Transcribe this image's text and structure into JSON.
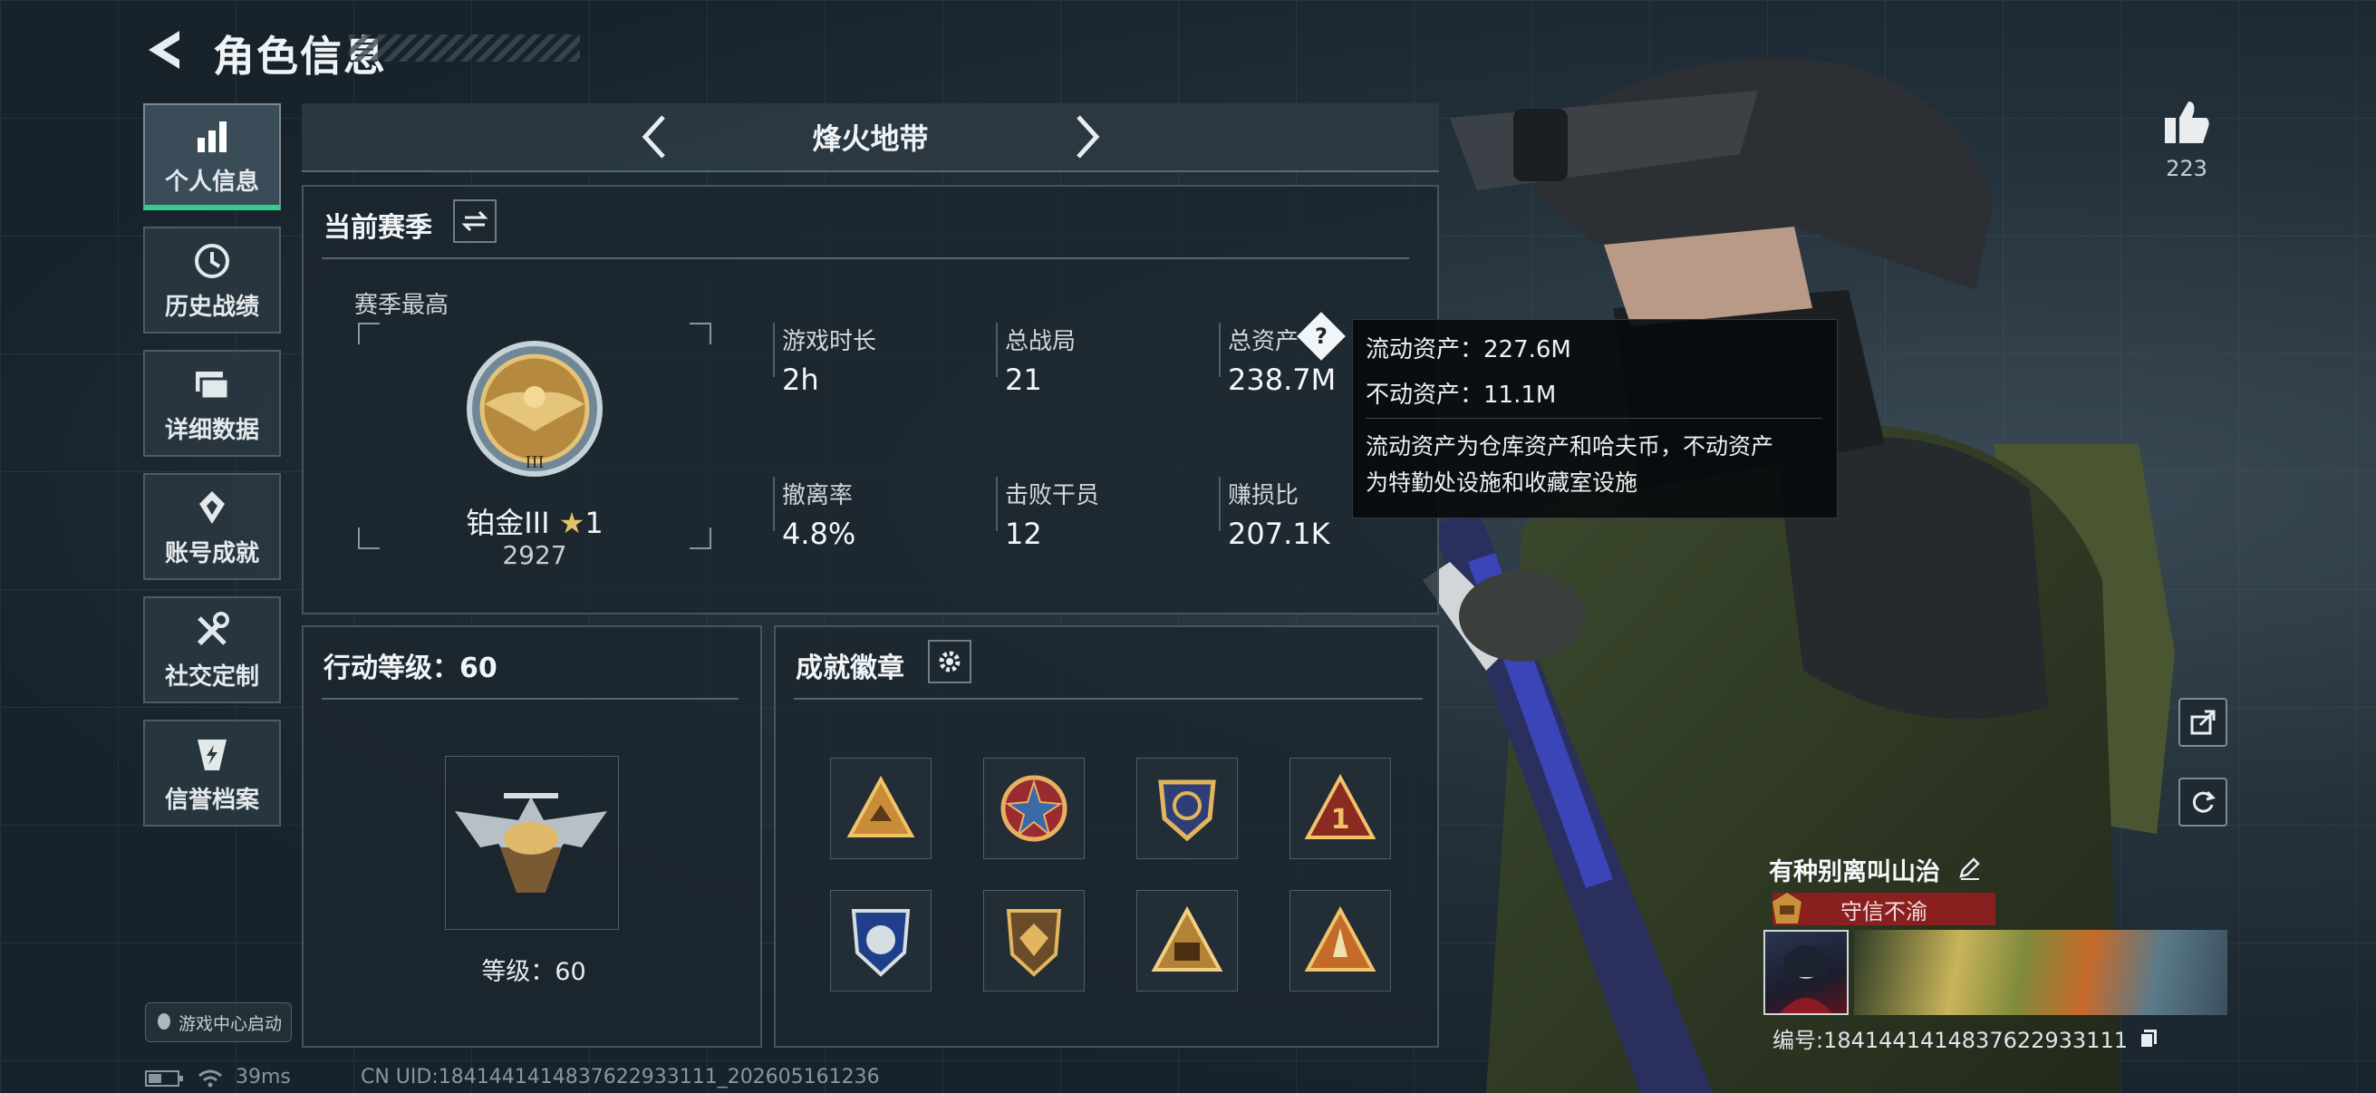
{
  "header": {
    "title": "角色信息"
  },
  "nav": {
    "items": [
      {
        "label": "个人信息",
        "icon": "bar-chart-icon",
        "active": true
      },
      {
        "label": "历史战绩",
        "icon": "history-icon"
      },
      {
        "label": "详细数据",
        "icon": "folder-icon"
      },
      {
        "label": "账号成就",
        "icon": "achievement-icon"
      },
      {
        "label": "社交定制",
        "icon": "tools-icon"
      },
      {
        "label": "信誉档案",
        "icon": "credit-icon"
      }
    ],
    "launch_badge": "游戏中心启动"
  },
  "mode": {
    "title": "烽火地带"
  },
  "season": {
    "title": "当前赛季",
    "best_label": "赛季最高",
    "rank_name": "铂金III",
    "rank_stars": "1",
    "rank_score": "2927",
    "stats": [
      {
        "label": "游戏时长",
        "value": "2h"
      },
      {
        "label": "总战局",
        "value": "21"
      },
      {
        "label": "总资产",
        "value": "238.7M"
      },
      {
        "label": "撤离率",
        "value": "4.8%"
      },
      {
        "label": "击败干员",
        "value": "12"
      },
      {
        "label": "赚损比",
        "value": "207.1K"
      }
    ]
  },
  "tooltip": {
    "liquid": "流动资产：227.6M",
    "fixed": "不动资产：11.1M",
    "desc_line1": "流动资产为仓库资产和哈夫币，不动资产",
    "desc_line2": "为特勤处设施和收藏室设施"
  },
  "action_level": {
    "title": "行动等级：60",
    "level_text": "等级：60"
  },
  "badges": {
    "title": "成就徽章",
    "count": 8
  },
  "like": {
    "count": "223"
  },
  "player": {
    "name": "有种别离叫山治",
    "honor": "守信不渝",
    "uid_line": "编号:1841441414837622933111"
  },
  "footer": {
    "ping": "39ms",
    "cn_uid": "CN UID:1841441414837622933111_202605161236"
  },
  "colors": {
    "accent_green": "#31d08a",
    "honor_red": "#8a1f1f",
    "panel_bg": "#1c262e"
  }
}
